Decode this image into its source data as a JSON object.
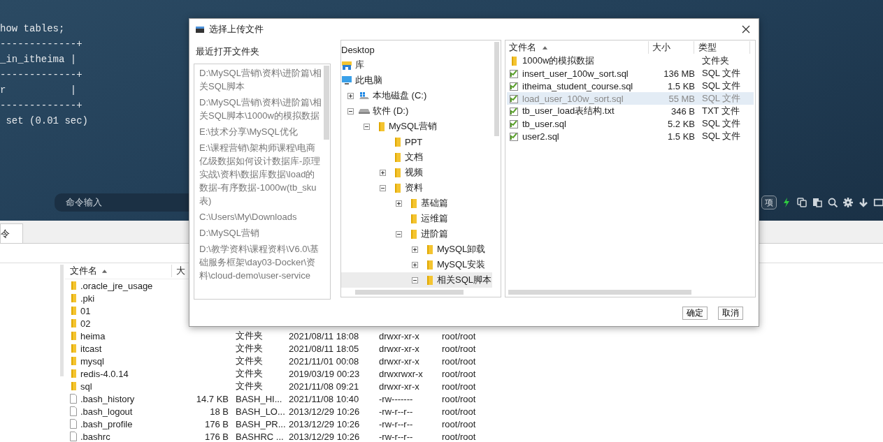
{
  "terminal": {
    "lines": [
      "how tables;",
      "-------------+",
      "_in_itheima |",
      "-------------+",
      "r           |",
      "-------------+",
      " set (0.01 sec)"
    ],
    "command_placeholder": "命令输入",
    "option_button": "项"
  },
  "tabs": [
    {
      "label": "令",
      "selected": true
    }
  ],
  "file_table": {
    "columns": [
      "文件名",
      "大"
    ],
    "rows": [
      {
        "name": ".oracle_jre_usage",
        "kind": "folder"
      },
      {
        "name": ".pki",
        "kind": "folder"
      },
      {
        "name": "01",
        "kind": "folder"
      },
      {
        "name": "02",
        "kind": "folder"
      },
      {
        "name": "heima",
        "kind": "folder",
        "type": "文件夹",
        "modified": "2021/08/11 18:08",
        "permissions": "drwxr-xr-x",
        "owner": "root/root"
      },
      {
        "name": "itcast",
        "kind": "folder",
        "type": "文件夹",
        "modified": "2021/08/11 18:05",
        "permissions": "drwxr-xr-x",
        "owner": "root/root"
      },
      {
        "name": "mysql",
        "kind": "folder",
        "type": "文件夹",
        "modified": "2021/11/01 00:08",
        "permissions": "drwxr-xr-x",
        "owner": "root/root"
      },
      {
        "name": "redis-4.0.14",
        "kind": "folder",
        "type": "文件夹",
        "modified": "2019/03/19 00:23",
        "permissions": "drwxrwxr-x",
        "owner": "root/root"
      },
      {
        "name": "sql",
        "kind": "folder",
        "type": "文件夹",
        "modified": "2021/11/08 09:21",
        "permissions": "drwxr-xr-x",
        "owner": "root/root"
      },
      {
        "name": ".bash_history",
        "kind": "file",
        "size": "14.7 KB",
        "type": "BASH_HI...",
        "modified": "2021/11/08 10:40",
        "permissions": "-rw-------",
        "owner": "root/root"
      },
      {
        "name": ".bash_logout",
        "kind": "file",
        "size": "18 B",
        "type": "BASH_LO...",
        "modified": "2013/12/29 10:26",
        "permissions": "-rw-r--r--",
        "owner": "root/root"
      },
      {
        "name": ".bash_profile",
        "kind": "file",
        "size": "176 B",
        "type": "BASH_PR...",
        "modified": "2013/12/29 10:26",
        "permissions": "-rw-r--r--",
        "owner": "root/root"
      },
      {
        "name": ".bashrc",
        "kind": "file",
        "size": "176 B",
        "type": "BASHRC ...",
        "modified": "2013/12/29 10:26",
        "permissions": "-rw-r--r--",
        "owner": "root/root"
      }
    ]
  },
  "dialog": {
    "title": "选择上传文件",
    "recent_label": "最近打开文件夹",
    "recent_folders": [
      "D:\\MySQL营销\\资料\\进阶篇\\相关SQL脚本",
      "D:\\MySQL营销\\资料\\进阶篇\\相关SQL脚本\\1000w的模拟数据",
      "E:\\技术分享\\MySQL优化",
      "E:\\课程营销\\架构师课程\\电商亿级数据如何设计数据库-原理实战\\资料\\数据库数据\\load的数据-有序数据-1000w(tb_sku表)",
      "C:\\Users\\My\\Downloads",
      "D:\\MySQL营销",
      "D:\\教学资料\\课程资料\\V6.0\\基础服务框架\\day03-Docker\\资料\\cloud-demo\\user-service"
    ],
    "tree": [
      {
        "label": "Desktop",
        "kind": "desktop",
        "selected": false
      },
      {
        "label": "库",
        "kind": "library",
        "selected": false
      },
      {
        "label": "此电脑",
        "kind": "computer",
        "selected": false,
        "children": [
          {
            "label": "本地磁盘 (C:)",
            "kind": "system-drive",
            "expanded": false,
            "selected": false
          },
          {
            "label": "软件 (D:)",
            "kind": "drive",
            "expanded": true,
            "selected": false,
            "children": [
              {
                "label": "MySQL营销",
                "kind": "folder",
                "expanded": true,
                "selected": false,
                "children": [
                  {
                    "label": "PPT",
                    "kind": "folder",
                    "selected": false
                  },
                  {
                    "label": "文档",
                    "kind": "folder",
                    "selected": false
                  },
                  {
                    "label": "视频",
                    "kind": "folder",
                    "expanded": false,
                    "selected": false
                  },
                  {
                    "label": "资料",
                    "kind": "folder",
                    "expanded": true,
                    "selected": false,
                    "children": [
                      {
                        "label": "基础篇",
                        "kind": "folder",
                        "expanded": false,
                        "selected": false
                      },
                      {
                        "label": "运维篇",
                        "kind": "folder",
                        "selected": false
                      },
                      {
                        "label": "进阶篇",
                        "kind": "folder",
                        "expanded": true,
                        "selected": false,
                        "children": [
                          {
                            "label": "MySQL卸载",
                            "kind": "folder",
                            "expanded": false,
                            "selected": false
                          },
                          {
                            "label": "MySQL安装",
                            "kind": "folder",
                            "expanded": false,
                            "selected": false
                          },
                          {
                            "label": "相关SQL脚本",
                            "kind": "folder",
                            "expanded": true,
                            "selected": true
                          }
                        ]
                      }
                    ]
                  }
                ]
              }
            ]
          }
        ]
      }
    ],
    "file_list": {
      "columns": [
        "文件名",
        "大小",
        "类型"
      ],
      "rows": [
        {
          "name": "1000w的模拟数据",
          "kind": "folder",
          "type": "文件夹",
          "selected": false
        },
        {
          "name": "insert_user_100w_sort.sql",
          "kind": "script",
          "size": "136 MB",
          "type": "SQL 文件",
          "selected": false
        },
        {
          "name": "itheima_student_course.sql",
          "kind": "script",
          "size": "1.5 KB",
          "type": "SQL 文件",
          "selected": false
        },
        {
          "name": "load_user_100w_sort.sql",
          "kind": "script",
          "size": "55 MB",
          "type": "SQL 文件",
          "selected": true
        },
        {
          "name": "tb_user_load表结构.txt",
          "kind": "script",
          "size": "346 B",
          "type": "TXT 文件",
          "selected": false
        },
        {
          "name": "tb_user.sql",
          "kind": "script",
          "size": "5.2 KB",
          "type": "SQL 文件",
          "selected": false
        },
        {
          "name": "user2.sql",
          "kind": "script",
          "size": "1.5 KB",
          "type": "SQL 文件",
          "selected": false
        }
      ]
    },
    "buttons": [
      "确定",
      "取消"
    ]
  }
}
